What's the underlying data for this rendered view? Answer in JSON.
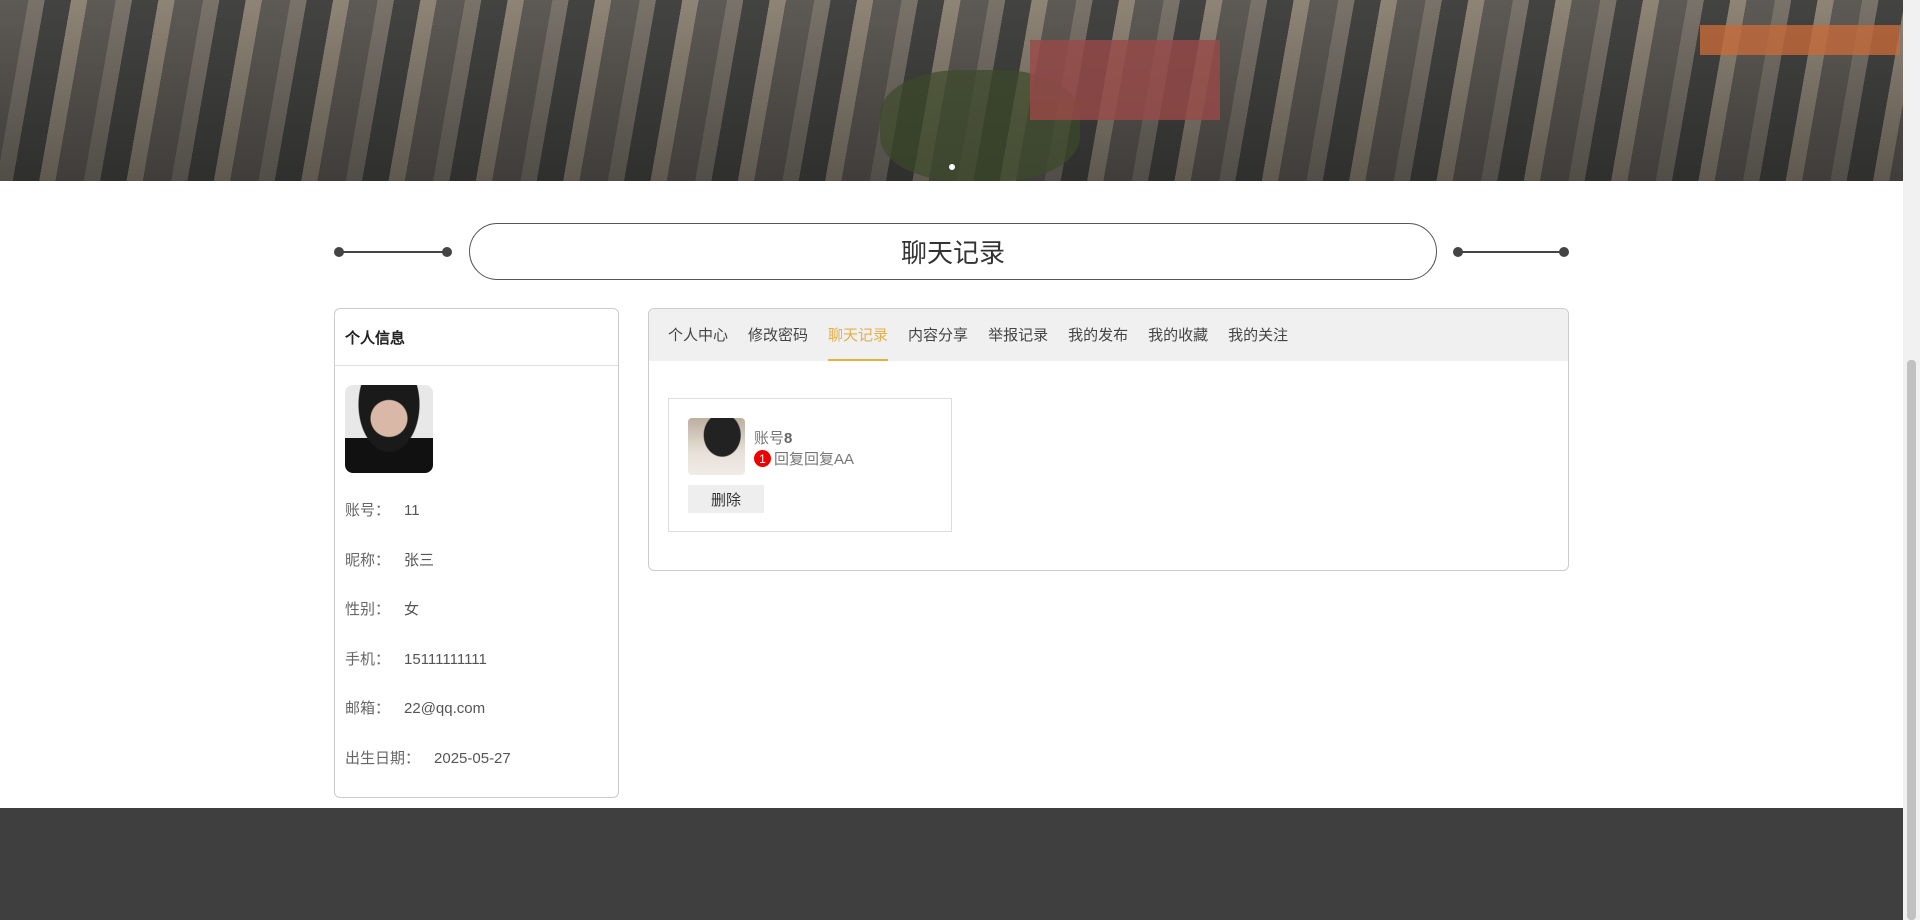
{
  "banner": {
    "carousel_dots": 1,
    "active_dot": 1
  },
  "section_title": "聊天记录",
  "profile": {
    "header": "个人信息",
    "fields": [
      {
        "label": "账号：",
        "value": "11"
      },
      {
        "label": "昵称：",
        "value": "张三"
      },
      {
        "label": "性别：",
        "value": "女"
      },
      {
        "label": "手机：",
        "value": "15111111111"
      },
      {
        "label": "邮箱：",
        "value": "22@qq.com"
      },
      {
        "label": "出生日期：",
        "value": "2025-05-27"
      }
    ]
  },
  "tabs": [
    "个人中心",
    "修改密码",
    "聊天记录",
    "内容分享",
    "举报记录",
    "我的发布",
    "我的收藏",
    "我的关注"
  ],
  "active_tab": "聊天记录",
  "chat": {
    "name_prefix": "账号",
    "name_num": "8",
    "unread": "1",
    "message": "回复回复AA",
    "delete_label": "删除"
  },
  "colors": {
    "accent": "#e3b04b",
    "footer": "#3f3f3f",
    "badge": "#ee0000"
  }
}
